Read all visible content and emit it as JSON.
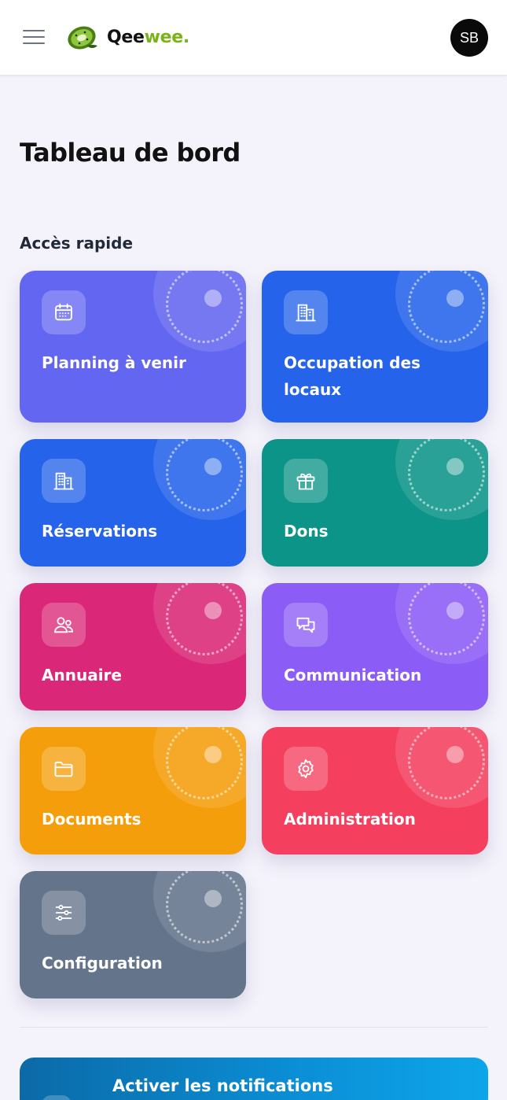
{
  "header": {
    "logo_part1": "Qee",
    "logo_part2": "wee.",
    "avatar_initials": "SB"
  },
  "page_title": "Tableau de bord",
  "quick_access": {
    "title": "Accès rapide",
    "items": [
      {
        "label": "Planning à venir",
        "icon": "calendar-icon",
        "color": "#6366f1"
      },
      {
        "label": "Occupation des locaux",
        "icon": "building-icon",
        "color": "#2563eb"
      },
      {
        "label": "Réservations",
        "icon": "building-icon",
        "color": "#2563eb"
      },
      {
        "label": "Dons",
        "icon": "gift-icon",
        "color": "#0d9488"
      },
      {
        "label": "Annuaire",
        "icon": "users-icon",
        "color": "#db2777"
      },
      {
        "label": "Communication",
        "icon": "chat-icon",
        "color": "#8b5cf6"
      },
      {
        "label": "Documents",
        "icon": "folder-icon",
        "color": "#f59e0b"
      },
      {
        "label": "Administration",
        "icon": "gear-icon",
        "color": "#f43f5e"
      },
      {
        "label": "Configuration",
        "icon": "sliders-icon",
        "color": "#64748b"
      }
    ]
  },
  "notifications": {
    "title": "Activer les notifications",
    "color": "#0b8fd6"
  },
  "colors": {
    "brand_green": "#7ab317",
    "background": "#f4f3fb"
  }
}
